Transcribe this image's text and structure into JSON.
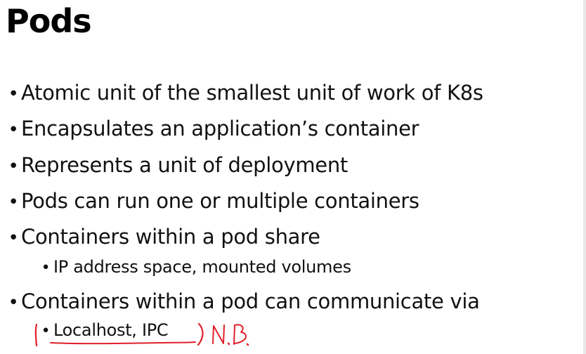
{
  "slide": {
    "title": "Pods",
    "bullets": [
      {
        "level": 1,
        "text": "Atomic unit of the smallest unit of work of K8s"
      },
      {
        "level": 1,
        "text": "Encapsulates an application’s container"
      },
      {
        "level": 1,
        "text": "Represents a unit of deployment"
      },
      {
        "level": 1,
        "text": "Pods can run one or multiple containers"
      },
      {
        "level": 1,
        "text": "Containers within a pod share"
      },
      {
        "level": 2,
        "text": "IP address space, mounted volumes"
      },
      {
        "level": 1,
        "text": "Containers within a pod can communicate via"
      },
      {
        "level": 2,
        "text": "Localhost, IPC"
      }
    ],
    "bullet_glyph": "•",
    "handwritten_note": "N.B."
  },
  "colors": {
    "text": "#111111",
    "title": "#000000",
    "annotation": "#e0202a",
    "background": "#ffffff"
  }
}
